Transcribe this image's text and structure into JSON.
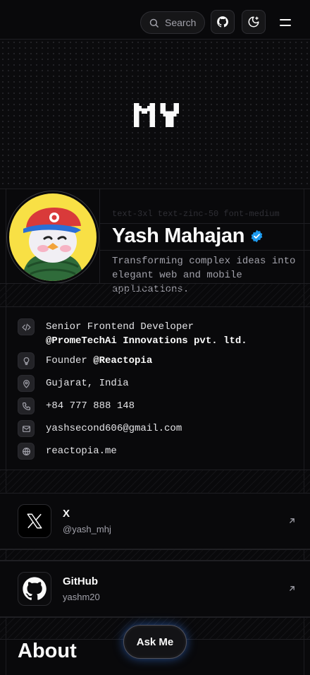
{
  "header": {
    "search_label": "Search"
  },
  "hero": {
    "text": "MY"
  },
  "profile": {
    "hint": "text-3xl text-zinc-50 font-medium",
    "name": "Yash Mahajan",
    "tagline": "Transforming complex ideas into elegant web and mobile applications."
  },
  "info": [
    {
      "icon": "code-icon",
      "text": "Senior Frontend Developer",
      "bold": "@PromeTechAi Innovations pvt. ltd."
    },
    {
      "icon": "lightbulb-icon",
      "text": "Founder ",
      "bold": "@Reactopia"
    },
    {
      "icon": "map-pin-icon",
      "text": "Gujarat, India"
    },
    {
      "icon": "phone-icon",
      "text": "+84 777 888 148"
    },
    {
      "icon": "mail-icon",
      "text": "yashsecond606@gmail.com"
    },
    {
      "icon": "globe-icon",
      "text": "reactopia.me"
    }
  ],
  "social": [
    {
      "icon": "x-logo-icon",
      "title": "X",
      "handle": "@yash_mhj"
    },
    {
      "icon": "github-logo-icon",
      "title": "GitHub",
      "handle": "yashm20"
    }
  ],
  "about": {
    "title": "About"
  },
  "ask_button": {
    "label": "Ask Me"
  },
  "colors": {
    "background": "#09090b",
    "verified_badge": "#1d9bf0",
    "muted_text": "#a1a1aa"
  }
}
